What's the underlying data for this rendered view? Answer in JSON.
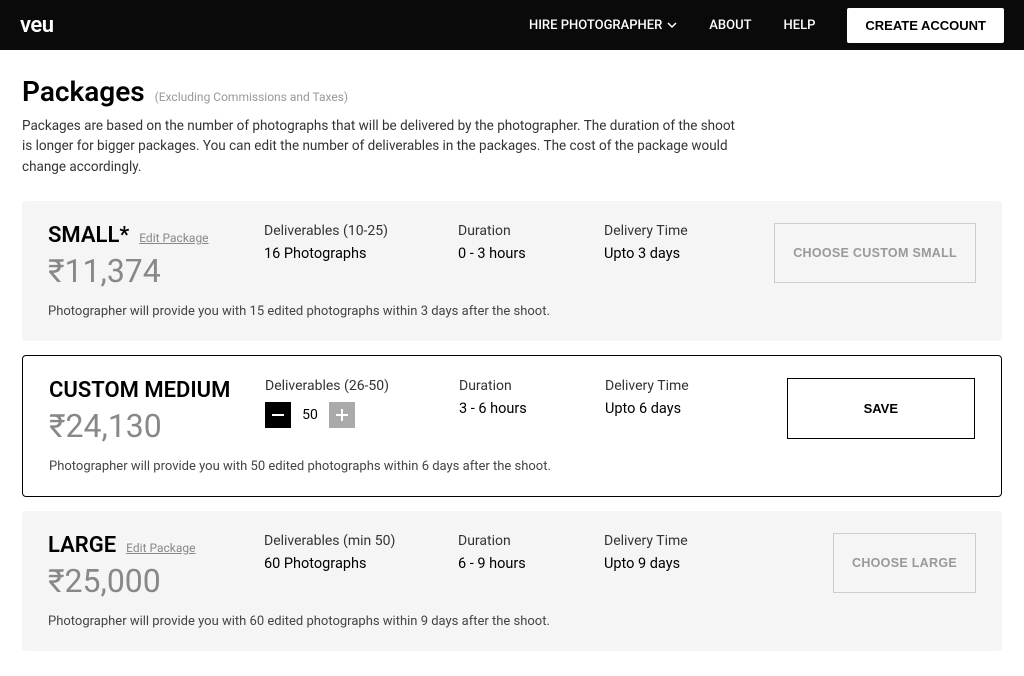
{
  "header": {
    "logo": "veu",
    "nav": {
      "hire": "HIRE PHOTOGRAPHER",
      "about": "ABOUT",
      "help": "HELP"
    },
    "cta": "CREATE ACCOUNT"
  },
  "page": {
    "title": "Packages",
    "subtitle": "(Excluding Commissions and Taxes)",
    "description": "Packages are based on the number of photographs that will be delivered by the photographer. The duration of the shoot is longer for bigger packages. You can edit the number of deliverables in the packages. The cost of the package would change accordingly."
  },
  "labels": {
    "deliverables": "Deliverables",
    "duration": "Duration",
    "delivery_time": "Delivery Time",
    "edit": "Edit Package"
  },
  "packages": [
    {
      "name": "SMALL*",
      "price": "₹11,374",
      "deliverables_range": "(10-25)",
      "deliverables_value": "16 Photographs",
      "duration": "0 - 3 hours",
      "delivery_time": "Upto 3 days",
      "action_label": "CHOOSE CUSTOM SMALL",
      "note": "Photographer will provide you with 15 edited photographs within 3 days after the shoot.",
      "editable": true,
      "active": false
    },
    {
      "name": "CUSTOM MEDIUM",
      "price": "₹24,130",
      "deliverables_range": "(26-50)",
      "stepper_value": "50",
      "duration": "3 - 6 hours",
      "delivery_time": "Upto 6 days",
      "action_label": "SAVE",
      "note": "Photographer will provide you with 50 edited photographs within 6 days after the shoot.",
      "editable": false,
      "active": true
    },
    {
      "name": "LARGE",
      "price": "₹25,000",
      "deliverables_range": "(min 50)",
      "deliverables_value": "60 Photographs",
      "duration": "6 - 9 hours",
      "delivery_time": "Upto 9 days",
      "action_label": "CHOOSE LARGE",
      "note": "Photographer will provide you with 60 edited photographs within 9 days after the shoot.",
      "editable": true,
      "active": false
    }
  ]
}
